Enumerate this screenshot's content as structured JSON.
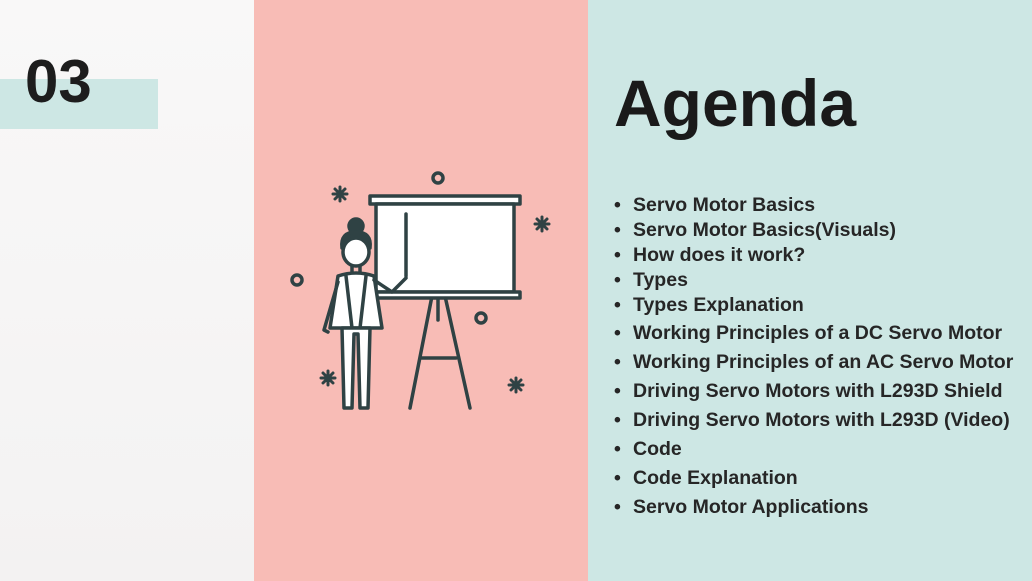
{
  "section": {
    "number": "03"
  },
  "agenda": {
    "title": "Agenda",
    "items": [
      "Servo Motor Basics",
      "Servo Motor Basics(Visuals)",
      "How does it work?",
      "Types",
      "Types Explanation",
      "Working Principles of a DC Servo Motor",
      "Working Principles of an AC Servo Motor",
      "Driving Servo Motors with L293D Shield",
      "Driving Servo Motors with L293D (Video)",
      "Code",
      "Code Explanation",
      "Servo Motor Applications"
    ]
  },
  "illustration": {
    "icon": "presenter-whiteboard-icon"
  },
  "colors": {
    "teal": "#cde7e4",
    "salmon": "#f8bcb6",
    "ink": "#1a1a1a",
    "outline": "#2f4244"
  }
}
